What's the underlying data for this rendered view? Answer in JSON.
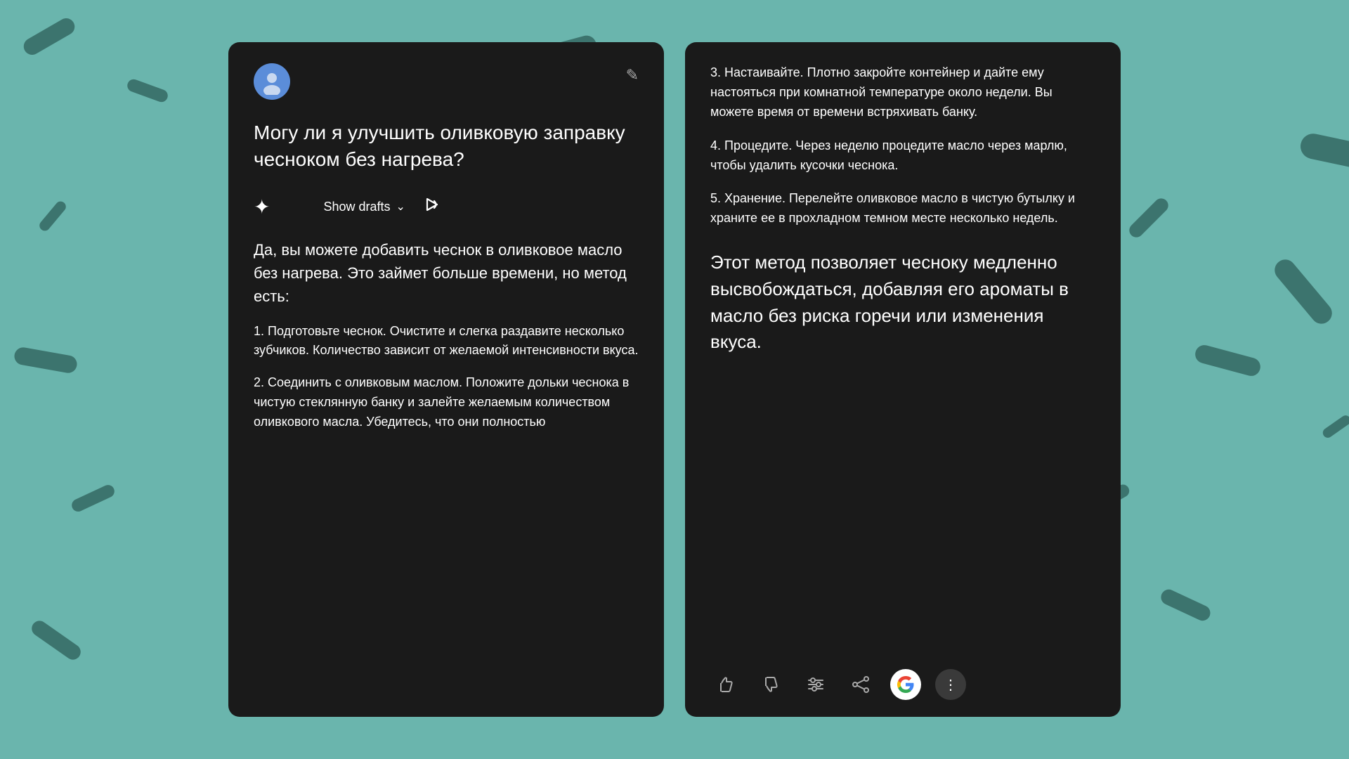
{
  "background": {
    "color": "#6ab5ad"
  },
  "leftCard": {
    "header": {
      "avatarLabel": "user-avatar",
      "editIconLabel": "✏"
    },
    "question": "Могу ли я улучшить оливковую заправку чесноком без нагрева?",
    "draftsBar": {
      "showDraftsLabel": "Show drafts",
      "chevron": "∨"
    },
    "answer": {
      "intro": "Да, вы можете добавить чеснок в оливковое масло без нагрева. Это займет больше времени, но метод есть:",
      "step1": "1. Подготовьте чеснок. Очистите и слегка раздавите несколько зубчиков. Количество зависит от желаемой интенсивности вкуса.",
      "step2": "2. Соединить с оливковым маслом. Положите дольки чеснока в чистую стеклянную банку и залейте желаемым количеством оливкового масла. Убедитесь, что они полностью"
    }
  },
  "rightCard": {
    "step3": "3. Настаивайте. Плотно закройте контейнер и дайте ему настояться при комнатной температуре около недели. Вы можете время от времени встряхивать банку.",
    "step4": "4. Процедите. Через неделю процедите масло через марлю, чтобы удалить кусочки чеснока.",
    "step5": "5. Хранение. Перелейте оливковое масло в чистую бутылку и храните ее в прохладном темном месте несколько недель.",
    "summary": "Этот метод позволяет чесноку медленно высвобождаться, добавляя его ароматы в масло без риска горечи или изменения вкуса.",
    "actions": {
      "thumbsUp": "👍",
      "thumbsDown": "👎",
      "sliders": "⚙",
      "share": "⎋",
      "more": "⋮"
    }
  }
}
